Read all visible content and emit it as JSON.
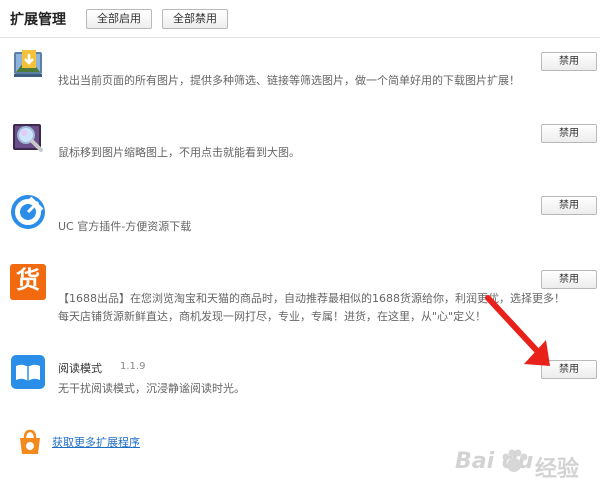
{
  "header": {
    "title": "扩展管理",
    "enable_all": "全部启用",
    "disable_all": "全部禁用"
  },
  "extensions": [
    {
      "icon": "photo-download-icon",
      "name": "",
      "version": "",
      "description": "找出当前页面的所有图片，提供多种筛选、链接等筛选图片，做一个简单好用的下载图片扩展！",
      "description2": "",
      "button": "禁用"
    },
    {
      "icon": "magnifier-zoom-icon",
      "name": "",
      "version": "",
      "description": "鼠标移到图片缩略图上，不用点击就能看到大图。",
      "description2": "",
      "button": "禁用"
    },
    {
      "icon": "uc-download-icon",
      "name": "",
      "version": "",
      "description": "UC 官方插件-方便资源下载",
      "description2": "",
      "button": "禁用"
    },
    {
      "icon": "goods-1688-icon",
      "icon_text": "货",
      "name": "",
      "version": "",
      "description": "【1688出品】在您浏览淘宝和天猫的商品时，自动推荐最相似的1688货源给你，利润更优，选择更多！",
      "description2": "每天店铺货源新鲜直达，商机发现一网打尽，专业，专属！进货，在这里，从\"心\"定义！",
      "button": "禁用"
    },
    {
      "icon": "reading-book-icon",
      "name": "阅读模式",
      "version": "1.1.9",
      "description": "无干扰阅读模式，沉浸静谧阅读时光。",
      "description2": "",
      "button": "禁用"
    }
  ],
  "more_link": "获取更多扩展程序",
  "watermark": {
    "brand": "Bai du",
    "cn": "经验"
  },
  "colors": {
    "link": "#1f6fc5",
    "arrow": "#e8221b",
    "goods_orange": "#f26a10",
    "book_blue": "#2a8ee8"
  }
}
